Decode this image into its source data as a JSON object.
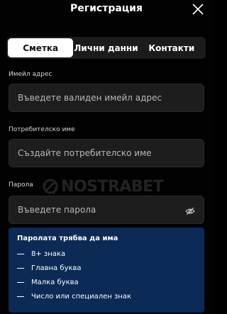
{
  "header": {
    "title": "Регистрация"
  },
  "tabs": [
    {
      "label": "Сметка",
      "active": true
    },
    {
      "label": "Лични данни",
      "active": false
    },
    {
      "label": "Контакти",
      "active": false
    }
  ],
  "form": {
    "email": {
      "label": "Имейл адрес",
      "placeholder": "Въведете валиден имейл адрес",
      "value": ""
    },
    "username": {
      "label": "Потребителско име",
      "placeholder": "Създайте потребителско име",
      "value": ""
    },
    "password": {
      "label": "Парола",
      "placeholder": "Въведете парола",
      "value": "",
      "icon": "eye-slash-icon"
    }
  },
  "watermark": {
    "text": "NOSTRABET"
  },
  "password_rules": {
    "title": "Паролата трябва да има",
    "items": [
      "8+ знака",
      "Главна буква",
      "Малка буква",
      "Число или специален знак"
    ]
  },
  "colors": {
    "background": "#020202",
    "tab_bar": "#1b1b1b",
    "tab_active": "#ffffff",
    "field_bg": "#1d1d1d",
    "rules_bg": "#0b2a55"
  }
}
